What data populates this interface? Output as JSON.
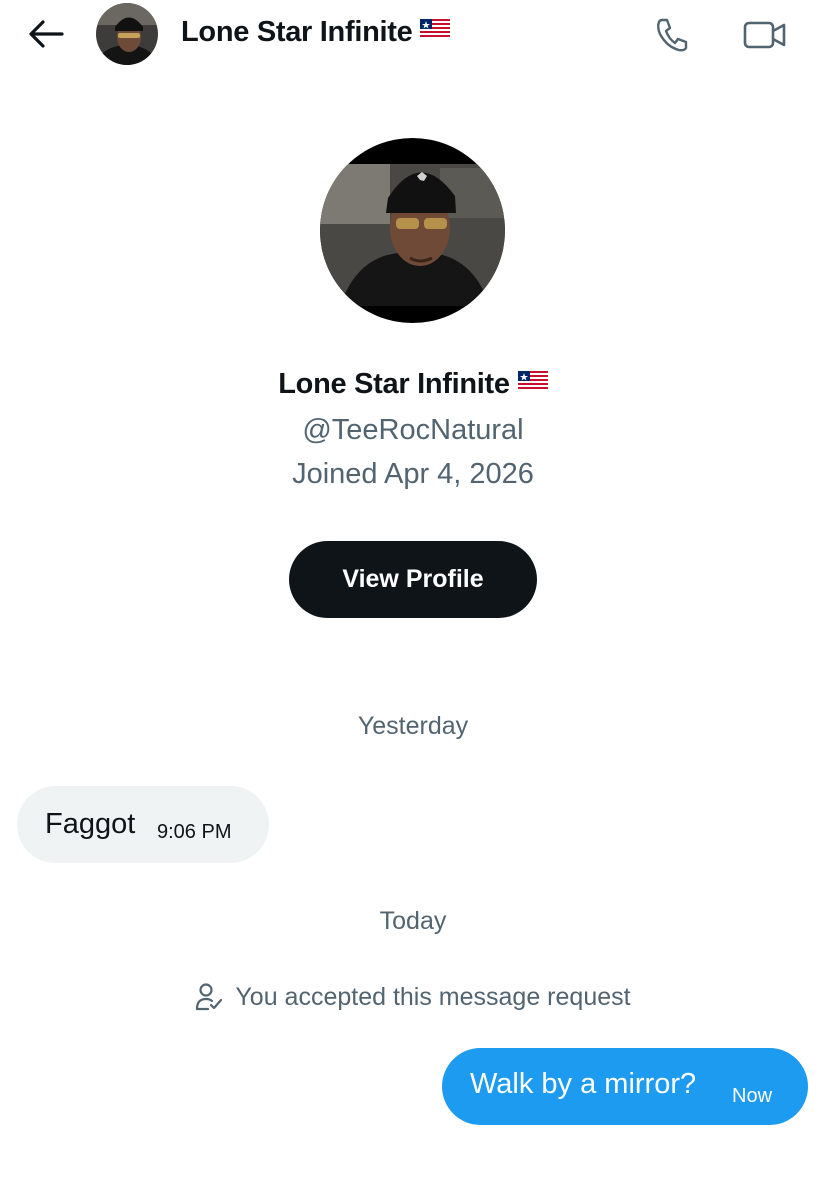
{
  "header": {
    "name": "Lone Star Infinite",
    "back_icon": "arrow-left-icon",
    "call_icon": "phone-icon",
    "video_icon": "video-camera-icon"
  },
  "profile": {
    "name": "Lone Star Infinite",
    "handle": "@TeeRocNatural",
    "joined": "Joined Apr 4, 2026",
    "view_profile_label": "View Profile"
  },
  "conversation": {
    "sections": [
      {
        "date_label": "Yesterday",
        "messages": [
          {
            "direction": "incoming",
            "text": "Faggot",
            "time": "9:06 PM"
          }
        ]
      },
      {
        "date_label": "Today",
        "notice": "You accepted this message request",
        "messages": [
          {
            "direction": "outgoing",
            "text": "Walk by a mirror?",
            "time": "Now"
          }
        ]
      }
    ]
  },
  "colors": {
    "text_primary": "#0f1419",
    "text_secondary": "#536471",
    "incoming_bubble": "#eff3f4",
    "outgoing_bubble": "#1d9bf0",
    "button_dark": "#0f1419"
  }
}
